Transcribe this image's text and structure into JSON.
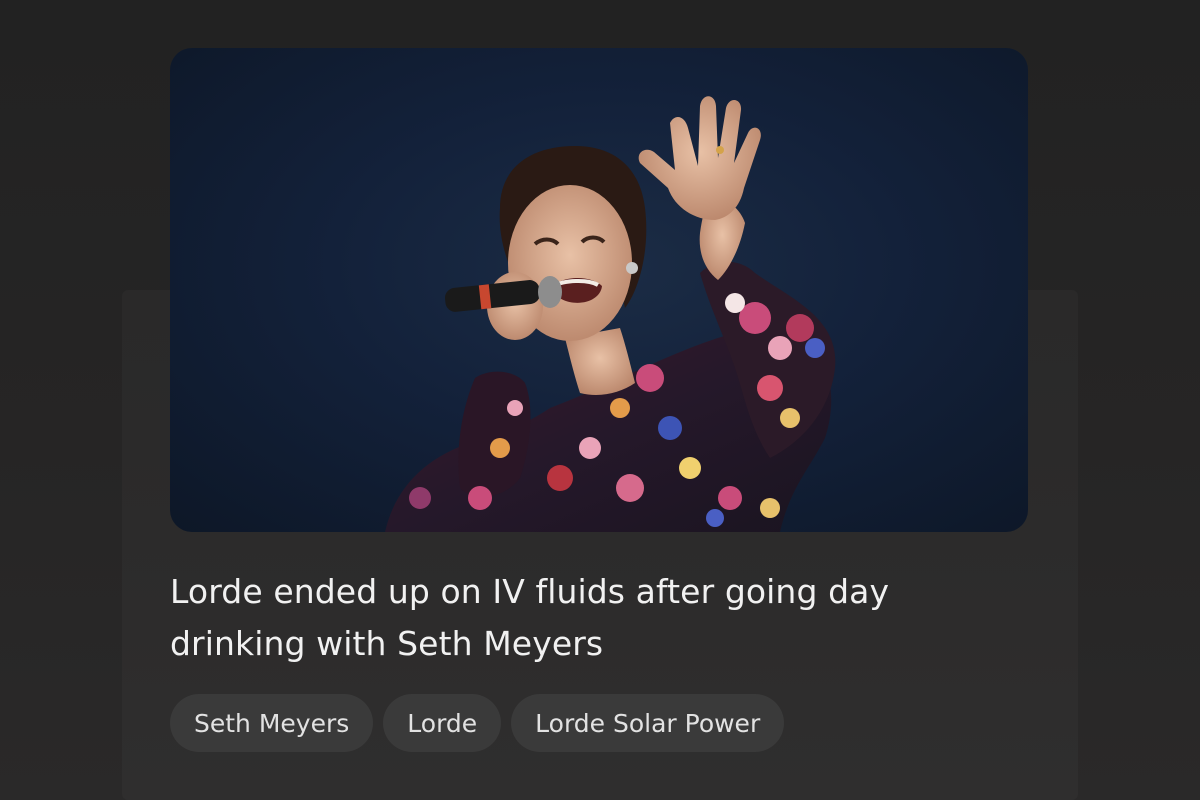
{
  "article": {
    "headline": "Lorde ended up on IV fluids after going day drinking with Seth Meyers",
    "image_alt": "Lorde singing into a microphone on stage, raising her hand, wearing a floral blouse",
    "chips": [
      {
        "label": "Seth Meyers"
      },
      {
        "label": "Lorde"
      },
      {
        "label": "Lorde Solar Power"
      }
    ]
  },
  "colors": {
    "background": "#232323",
    "chip_background": "#3a3a3a",
    "text": "#f1f1f1",
    "image_backdrop": "#13213a"
  }
}
